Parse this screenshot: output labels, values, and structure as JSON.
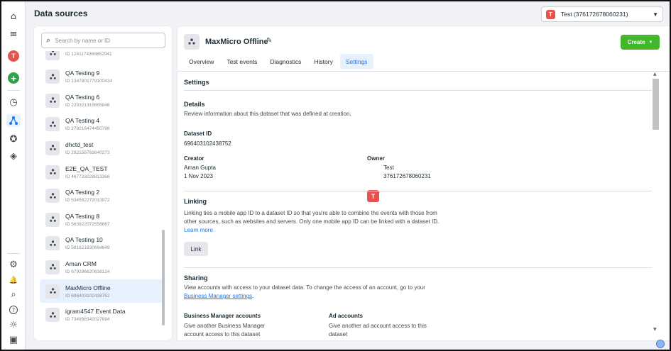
{
  "page": {
    "title": "Data sources"
  },
  "account_selector": {
    "badge": "T",
    "name": "Test (376172678060231)",
    "caret": "▼"
  },
  "rail": {
    "avatar_letter": "T",
    "plus": "+",
    "icons": {
      "home": "⌂",
      "menu": "≡",
      "speed": "◷",
      "events": "⋀",
      "star": "✪",
      "gem": "◈",
      "settings": "⚙",
      "bell": "🔔",
      "search": "⌕",
      "help": "?",
      "bug": "☼",
      "panel": "▣"
    }
  },
  "search": {
    "placeholder": "Search by name or ID",
    "icon": "⌕"
  },
  "datasets": [
    {
      "name": "",
      "id": "ID 1241174369852941"
    },
    {
      "name": "QA Testing 9",
      "id": "ID 1347801779100434"
    },
    {
      "name": "QA Testing 6",
      "id": "ID 229321319805846"
    },
    {
      "name": "QA Testing 4",
      "id": "ID 279216474450798"
    },
    {
      "name": "dhctd_test",
      "id": "ID 292158763640273"
    },
    {
      "name": "E2E_QA_TEST",
      "id": "ID 467733028813366"
    },
    {
      "name": "QA Testing 2",
      "id": "ID 534582272013972"
    },
    {
      "name": "QA Testing 8",
      "id": "ID 563922072556667"
    },
    {
      "name": "QA Testing 10",
      "id": "ID 581821830684649"
    },
    {
      "name": "Aman CRM",
      "id": "ID 679296620638124"
    },
    {
      "name": "MaxMicro Offline",
      "id": "ID 696403102438752"
    },
    {
      "name": "igram4547 Event Data",
      "id": "ID 734998342027894"
    }
  ],
  "selected_index": 10,
  "header": {
    "title": "MaxMicro Offline",
    "edit_icon": "✎",
    "create_label": "Create",
    "create_caret": "▼",
    "tabs": [
      {
        "label": "Overview"
      },
      {
        "label": "Test events"
      },
      {
        "label": "Diagnostics"
      },
      {
        "label": "History"
      },
      {
        "label": "Settings"
      }
    ],
    "active_tab": "Settings"
  },
  "settings": {
    "heading": "Settings",
    "details": {
      "title": "Details",
      "description": "Review information about this dataset that was defined at creation.",
      "dataset_id_label": "Dataset ID",
      "dataset_id": "696403102438752",
      "creator_label": "Creator",
      "creator_name": "Aman Gupta",
      "creator_date": "1 Nov 2023",
      "owner_label": "Owner",
      "owner_badge": "T",
      "owner_name": "Test",
      "owner_id": "376172678060231"
    },
    "linking": {
      "title": "Linking",
      "line1": "Linking ties a mobile app ID to a dataset ID so that you're able to combine the events with those from",
      "line2": "other sources, such as websites and servers. Only one mobile app ID can be linked with a dataset ID.",
      "learn_more": "Learn more",
      "button": "Link"
    },
    "sharing": {
      "title": "Sharing",
      "line1": "View accounts with access to your dataset data. To change the access of an account, go to your",
      "bm_link": "Business Manager settings",
      "period": ".",
      "bm_accounts_label": "Business Manager accounts",
      "bm_accounts_text1": "Give another Business Manager",
      "bm_accounts_text2": "account access to this dataset",
      "ad_accounts_label": "Ad accounts",
      "ad_accounts_text1": "Give another ad account access to this",
      "ad_accounts_text2": "dataset"
    }
  },
  "scrollbar": {
    "up": "▲",
    "down": "▼"
  }
}
